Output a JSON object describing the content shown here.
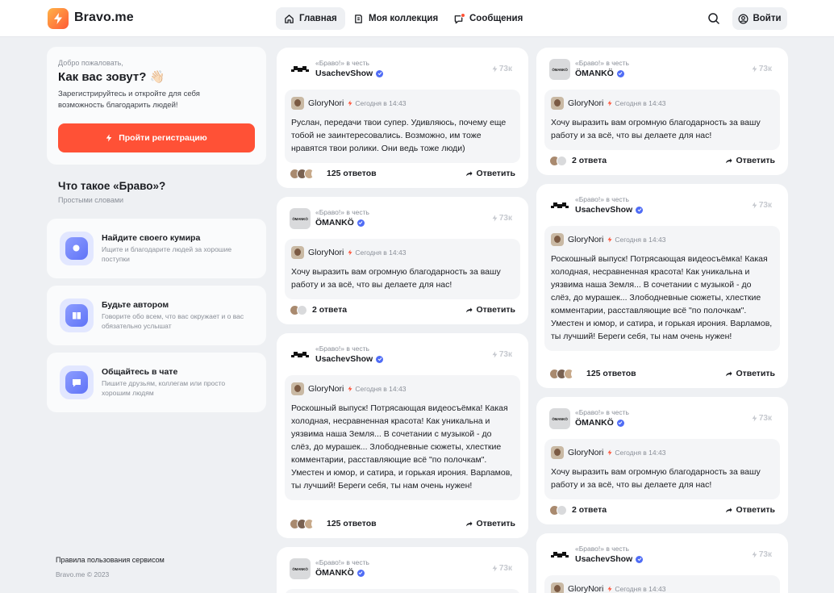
{
  "header": {
    "brand": "Bravo.me",
    "nav": [
      {
        "label": "Главная"
      },
      {
        "label": "Моя коллекция"
      },
      {
        "label": "Сообщения"
      }
    ],
    "login_label": "Войти"
  },
  "sidebar": {
    "welcome": {
      "greeting": "Добро пожаловать,",
      "question": "Как вас зовут? 👋🏻",
      "subtitle": "Зарегистрируйтесь и откройте для себя возможность благодарить людей!",
      "register_label": "Пройти регистрацию"
    },
    "what_title": "Что такое «Браво»?",
    "what_sub": "Простыми словами",
    "features": [
      {
        "title": "Найдите своего кумира",
        "desc": "Ищите и благодарите людей за хорошие поступки"
      },
      {
        "title": "Будьте автором",
        "desc": "Говорите обо всем, что вас окружает и о вас обязательно услышат"
      },
      {
        "title": "Общайтесь в чате",
        "desc": "Пишите друзьям, коллегам или просто хорошим людям"
      }
    ],
    "rules": "Правила пользования сервисом",
    "copyright": "Bravo.me © 2023"
  },
  "common": {
    "in_honor": "«Браво!» в честь",
    "bravo_count": "73к",
    "author": "GloryNori",
    "time": "Сегодня в 14:43",
    "reply_label": "Ответить",
    "omanko_logo": "ÖMANKÖ"
  },
  "cards": [
    {
      "hero": "UsachevShow",
      "text": "Руслан, передачи твои супер. Удивляюсь, почему еще тобой не заинтересовались. Возможно, им тоже нравятся твои ролики. Они ведь тоже люди)",
      "answers": "125 ответов"
    },
    {
      "hero": "ÖMANKÖ",
      "text": "Хочу выразить вам огромную благодарность за вашу работу и за всё, что вы делаете для нас!",
      "answers": "2 ответа"
    },
    {
      "hero": "UsachevShow",
      "text": "Роскошный выпуск! Потрясающая видеосъёмка! Какая холодная, несравненная красота! Как уникальна и уязвима наша Земля... В сочетании с музыкой  - до слёз, до мурашек... Злободневные сюжеты, хлесткие комментарии, расставляющие всё \"по полочкам\". Уместен и юмор, и сатира, и горькая ирония. Варламов, ты лучший! Береги себя, ты нам очень нужен!",
      "answers": "125 ответов"
    },
    {
      "hero": "ÖMANKÖ",
      "text": "",
      "answers": ""
    },
    {
      "hero": "ÖMANKÖ",
      "text": "Хочу выразить вам огромную благодарность за вашу работу и за всё, что вы делаете для нас!",
      "answers": "2 ответа"
    },
    {
      "hero": "UsachevShow",
      "text": "Роскошный выпуск! Потрясающая видеосъёмка! Какая холодная, несравненная красота! Как уникальна и уязвима наша Земля... В сочетании с музыкой  - до слёз, до мурашек... Злободневные сюжеты, хлесткие комментарии, расставляющие всё \"по полочкам\". Уместен и юмор, и сатира, и горькая ирония. Варламов, ты лучший! Береги себя, ты нам очень нужен!",
      "answers": "125 ответов"
    },
    {
      "hero": "ÖMANKÖ",
      "text": "Хочу выразить вам огромную благодарность за вашу работу и за всё, что вы делаете для нас!",
      "answers": "2 ответа"
    },
    {
      "hero": "UsachevShow",
      "text": "",
      "answers": ""
    }
  ],
  "colors": {
    "accent": "#ff5136",
    "verified": "#4f6cf5",
    "background": "#eef0f3"
  }
}
